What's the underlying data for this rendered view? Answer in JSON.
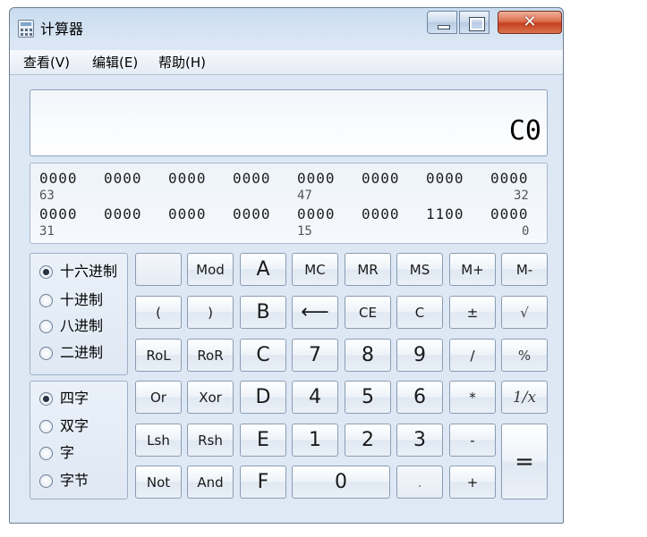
{
  "window": {
    "title": "计算器"
  },
  "menu": {
    "view": "查看(V)",
    "edit": "编辑(E)",
    "help": "帮助(H)"
  },
  "display": {
    "value": "C0",
    "bits": {
      "row1": [
        "0000",
        "0000",
        "0000",
        "0000",
        "0000",
        "0000",
        "0000",
        "0000"
      ],
      "row1_positions": {
        "left": "63",
        "middle": "47",
        "right": "32"
      },
      "row2": [
        "0000",
        "0000",
        "0000",
        "0000",
        "0000",
        "0000",
        "1100",
        "0000"
      ],
      "row2_positions": {
        "left": "31",
        "middle": "15",
        "right": "0"
      }
    }
  },
  "number_base": {
    "options": [
      "十六进制",
      "十进制",
      "八进制",
      "二进制"
    ],
    "selected": "十六进制"
  },
  "word_size": {
    "options": [
      "四字",
      "双字",
      "字",
      "字节"
    ],
    "selected": "四字"
  },
  "keys": {
    "blank": "",
    "mod": "Mod",
    "a": "A",
    "mc": "MC",
    "mr": "MR",
    "ms": "MS",
    "mplus": "M+",
    "mminus": "M-",
    "lparen": "(",
    "rparen": ")",
    "b": "B",
    "backspace": "⟵",
    "ce": "CE",
    "c": "C",
    "plusminus": "±",
    "sqrt": "√",
    "rol": "RoL",
    "ror": "RoR",
    "hex_c": "C",
    "n7": "7",
    "n8": "8",
    "n9": "9",
    "divide": "/",
    "percent": "%",
    "or": "Or",
    "xor": "Xor",
    "d": "D",
    "n4": "4",
    "n5": "5",
    "n6": "6",
    "multiply": "*",
    "reciprocal": "1/x",
    "lsh": "Lsh",
    "rsh": "Rsh",
    "e": "E",
    "n1": "1",
    "n2": "2",
    "n3": "3",
    "minus": "-",
    "equals": "=",
    "not": "Not",
    "and": "And",
    "f": "F",
    "n0": "0",
    "decimal": ".",
    "plus": "+"
  }
}
